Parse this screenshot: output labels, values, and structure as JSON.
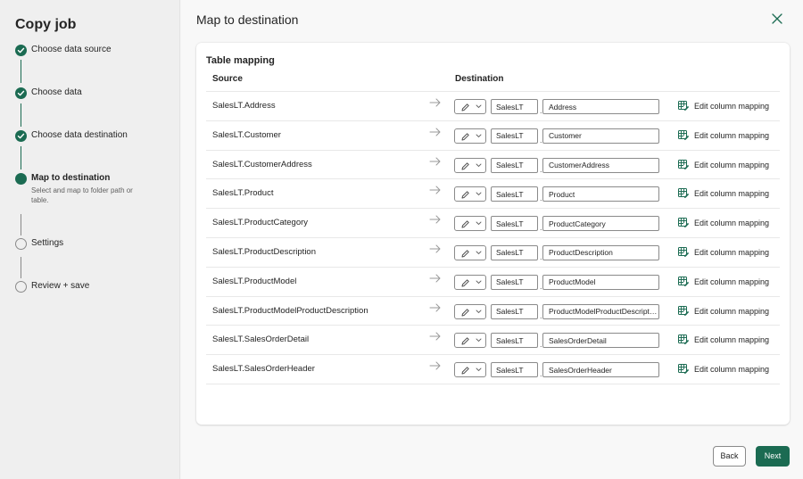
{
  "sidebar": {
    "title": "Copy job",
    "steps": [
      {
        "label": "Choose data source",
        "state": "done"
      },
      {
        "label": "Choose data",
        "state": "done"
      },
      {
        "label": "Choose data destination",
        "state": "done"
      },
      {
        "label": "Map to destination",
        "state": "current",
        "description": "Select and map to folder path or table."
      },
      {
        "label": "Settings",
        "state": "todo"
      },
      {
        "label": "Review + save",
        "state": "todo"
      }
    ]
  },
  "main": {
    "title": "Map to destination",
    "close_icon": "close-icon",
    "table_mapping": {
      "title": "Table mapping",
      "source_header": "Source",
      "destination_header": "Destination",
      "edit_label": "Edit column mapping",
      "rows": [
        {
          "source": "SalesLT.Address",
          "schema": "SalesLT",
          "table": "Address"
        },
        {
          "source": "SalesLT.Customer",
          "schema": "SalesLT",
          "table": "Customer"
        },
        {
          "source": "SalesLT.CustomerAddress",
          "schema": "SalesLT",
          "table": "CustomerAddress"
        },
        {
          "source": "SalesLT.Product",
          "schema": "SalesLT",
          "table": "Product"
        },
        {
          "source": "SalesLT.ProductCategory",
          "schema": "SalesLT",
          "table": "ProductCategory"
        },
        {
          "source": "SalesLT.ProductDescription",
          "schema": "SalesLT",
          "table": "ProductDescription"
        },
        {
          "source": "SalesLT.ProductModel",
          "schema": "SalesLT",
          "table": "ProductModel"
        },
        {
          "source": "SalesLT.ProductModelProductDescription",
          "schema": "SalesLT",
          "table": "ProductModelProductDescription"
        },
        {
          "source": "SalesLT.SalesOrderDetail",
          "schema": "SalesLT",
          "table": "SalesOrderDetail"
        },
        {
          "source": "SalesLT.SalesOrderHeader",
          "schema": "SalesLT",
          "table": "SalesOrderHeader"
        }
      ]
    }
  },
  "footer": {
    "back_label": "Back",
    "next_label": "Next"
  },
  "colors": {
    "accent": "#1b6b52"
  }
}
